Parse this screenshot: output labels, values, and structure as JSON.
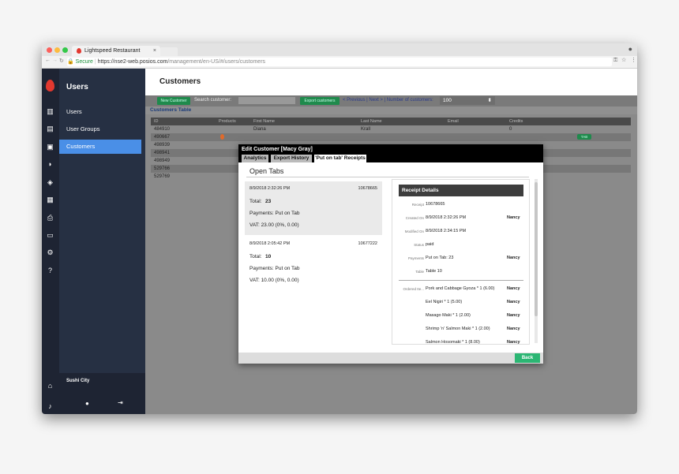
{
  "browser": {
    "tab_title": "Lightspeed Restaurant",
    "tab_close": "×",
    "secure_label": "Secure",
    "url_host": "https://nse2-web.posios.com",
    "url_path": "/management/en-US/#/users/customers"
  },
  "sidebar": {
    "heading": "Users",
    "items": [
      {
        "label": "Users",
        "active": false
      },
      {
        "label": "User Groups",
        "active": false
      },
      {
        "label": "Customers",
        "active": true
      }
    ],
    "location": "Sushi City"
  },
  "main": {
    "title": "Customers",
    "toolbar": {
      "new_customer": "New Customer",
      "search_label": "Search customer:",
      "export_customers": "Export customers",
      "prev_next": "< Previous | Next > | Number of customers:",
      "page_size": "100"
    },
    "table_title": "Customers Table",
    "columns": [
      "ID",
      "Products",
      "First Name",
      "Last Name",
      "Email",
      "Credits"
    ],
    "rows": [
      {
        "id": "484910",
        "first": "Diana",
        "last": "Krall",
        "credits": "0",
        "badge": ""
      },
      {
        "id": "490667",
        "first": "",
        "last": "",
        "credits": "",
        "badge": "TAB"
      },
      {
        "id": "498939",
        "first": "",
        "last": "",
        "credits": "",
        "badge": ""
      },
      {
        "id": "498941",
        "first": "",
        "last": "",
        "credits": "",
        "badge": ""
      },
      {
        "id": "498949",
        "first": "",
        "last": "",
        "credits": "",
        "badge": ""
      },
      {
        "id": "529766",
        "first": "",
        "last": "",
        "credits": "",
        "badge": ""
      },
      {
        "id": "529769",
        "first": "",
        "last": "",
        "credits": "",
        "badge": ""
      }
    ]
  },
  "modal": {
    "title": "Edit Customer [Macy Gray]",
    "tabs": [
      {
        "label": "Analytics",
        "selected": false
      },
      {
        "label": "Export History",
        "selected": false
      },
      {
        "label": "'Put on tab' Receipts",
        "selected": true
      }
    ],
    "section_title": "Open Tabs",
    "receipts": [
      {
        "date": "8/9/2018 2:32:26 PM",
        "number": "10678665",
        "total_label": "Total:",
        "total": "23",
        "payments": "Payments: Put on Tab",
        "vat": "VAT: 23.00 (0%, 0.00)",
        "selected": true
      },
      {
        "date": "8/9/2018 2:05:42 PM",
        "number": "10677222",
        "total_label": "Total:",
        "total": "10",
        "payments": "Payments: Put on Tab",
        "vat": "VAT: 10.00 (0%, 0.00)",
        "selected": false
      }
    ],
    "details": {
      "heading": "Receipt Details",
      "fields": [
        {
          "label": "Receipt",
          "value": "10678665",
          "owner": ""
        },
        {
          "label": "Created On",
          "value": "8/9/2018 2:32:26 PM",
          "owner": "Nancy"
        },
        {
          "label": "Modified On",
          "value": "8/9/2018 2:34:15 PM",
          "owner": ""
        },
        {
          "label": "Status",
          "value": "paid",
          "owner": ""
        },
        {
          "label": "Payments",
          "value": "Put on Tab: 23",
          "owner": "Nancy"
        },
        {
          "label": "Table",
          "value": "Table 10",
          "owner": ""
        }
      ],
      "ordered_label": "Ordered Ite...",
      "ordered_items": [
        {
          "value": "Pork and Cabbage Gyoza * 1 (6.00)",
          "owner": "Nancy"
        },
        {
          "value": "Eel Nigiri * 1 (5.00)",
          "owner": "Nancy"
        },
        {
          "value": "Masago Maki * 1 (2.00)",
          "owner": "Nancy"
        },
        {
          "value": "Shrimp 'n' Salmon Maki * 1 (2.00)",
          "owner": "Nancy"
        },
        {
          "value": "Salmon Hosomaki * 1 (8.00)",
          "owner": "Nancy"
        }
      ]
    },
    "back_label": "Back"
  },
  "colors": {
    "accent": "#4a8fe7",
    "brand": "#e2382f",
    "back": "#2bb673"
  }
}
